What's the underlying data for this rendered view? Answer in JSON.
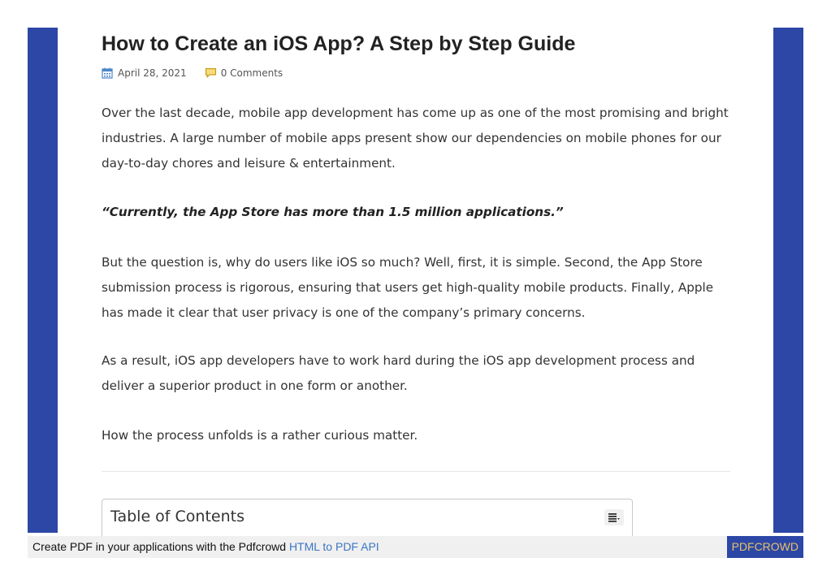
{
  "article": {
    "title": "How to Create an iOS App? A Step by Step Guide",
    "date": "April 28, 2021",
    "comments": "0 Comments",
    "paragraph_1": "Over the last decade, mobile app development has come up as one of the most promising and bright industries. A large number of mobile apps present show our dependencies on mobile phones for our day-to-day chores and leisure & entertainment.",
    "quote": "“Currently, the App Store has more than 1.5 million applications.”",
    "paragraph_2": "But the question is, why do users like iOS so much? Well, first, it is simple. Second, the App Store submission process is rigorous, ensuring that users get high-quality mobile products. Finally, Apple has made it clear that user privacy is one of the company’s primary concerns.",
    "paragraph_3": "As a result, iOS app developers have to work hard during the iOS app development process and deliver a superior product in one form or another.",
    "paragraph_4": "How the process unfolds is a rather curious matter."
  },
  "toc": {
    "title": "Table of Contents",
    "toggle_icon": "list-toggle-icon"
  },
  "icons": {
    "date": "calendar-icon",
    "comments": "comment-icon"
  },
  "footer": {
    "text": "Create PDF in your applications with the Pdfcrowd",
    "link": "HTML to PDF API",
    "brand": "PDFCROWD"
  },
  "colors": {
    "side_bar": "#2c47a6",
    "calendar_icon": "#4a86c8",
    "comment_icon": "#e7b83a",
    "link": "#3a75c4",
    "brand_text": "#e8c06a"
  }
}
